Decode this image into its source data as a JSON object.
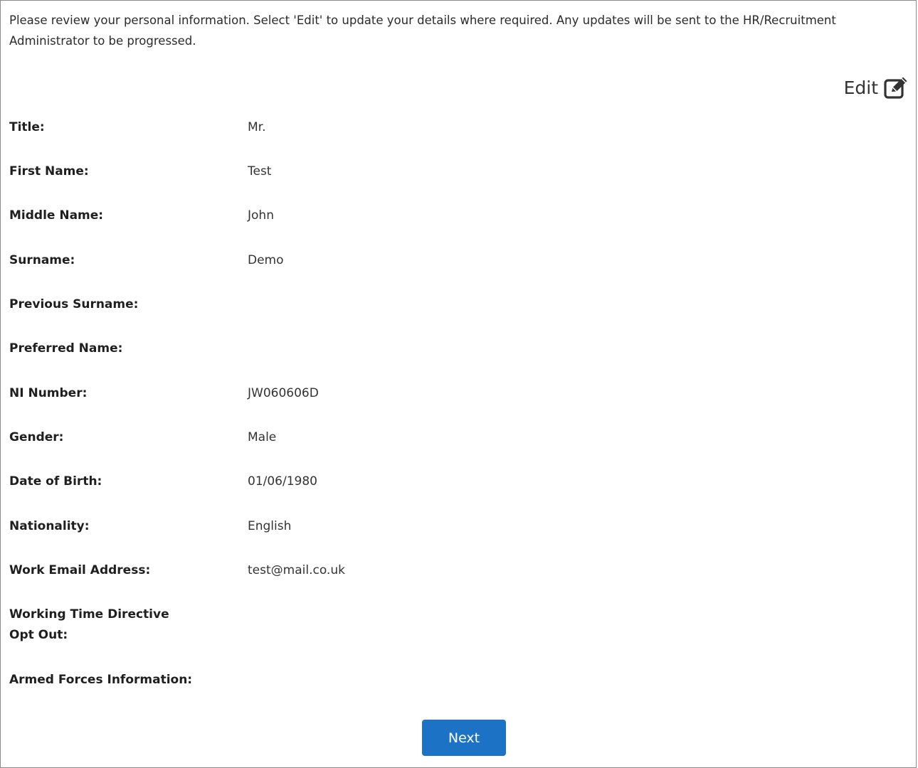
{
  "intro_text": "Please review your personal information. Select 'Edit' to update your details where required. Any updates will be sent to the HR/Recruitment Administrator to be progressed.",
  "edit": {
    "label": "Edit",
    "icon": "edit-square-icon"
  },
  "fields": [
    {
      "label": "Title:",
      "value": "Mr."
    },
    {
      "label": "First Name:",
      "value": "Test"
    },
    {
      "label": "Middle Name:",
      "value": "John"
    },
    {
      "label": "Surname:",
      "value": "Demo"
    },
    {
      "label": "Previous Surname:",
      "value": ""
    },
    {
      "label": "Preferred Name:",
      "value": ""
    },
    {
      "label": "NI Number:",
      "value": "JW060606D"
    },
    {
      "label": "Gender:",
      "value": "Male"
    },
    {
      "label": "Date of Birth:",
      "value": "01/06/1980"
    },
    {
      "label": "Nationality:",
      "value": "English"
    },
    {
      "label": "Work Email Address:",
      "value": "test@mail.co.uk"
    },
    {
      "label": "Working Time Directive Opt Out:",
      "value": ""
    },
    {
      "label": "Armed Forces Information:",
      "value": ""
    }
  ],
  "next_button": {
    "label": "Next"
  },
  "colors": {
    "primary_button": "#1c72c4",
    "text": "#222222"
  }
}
